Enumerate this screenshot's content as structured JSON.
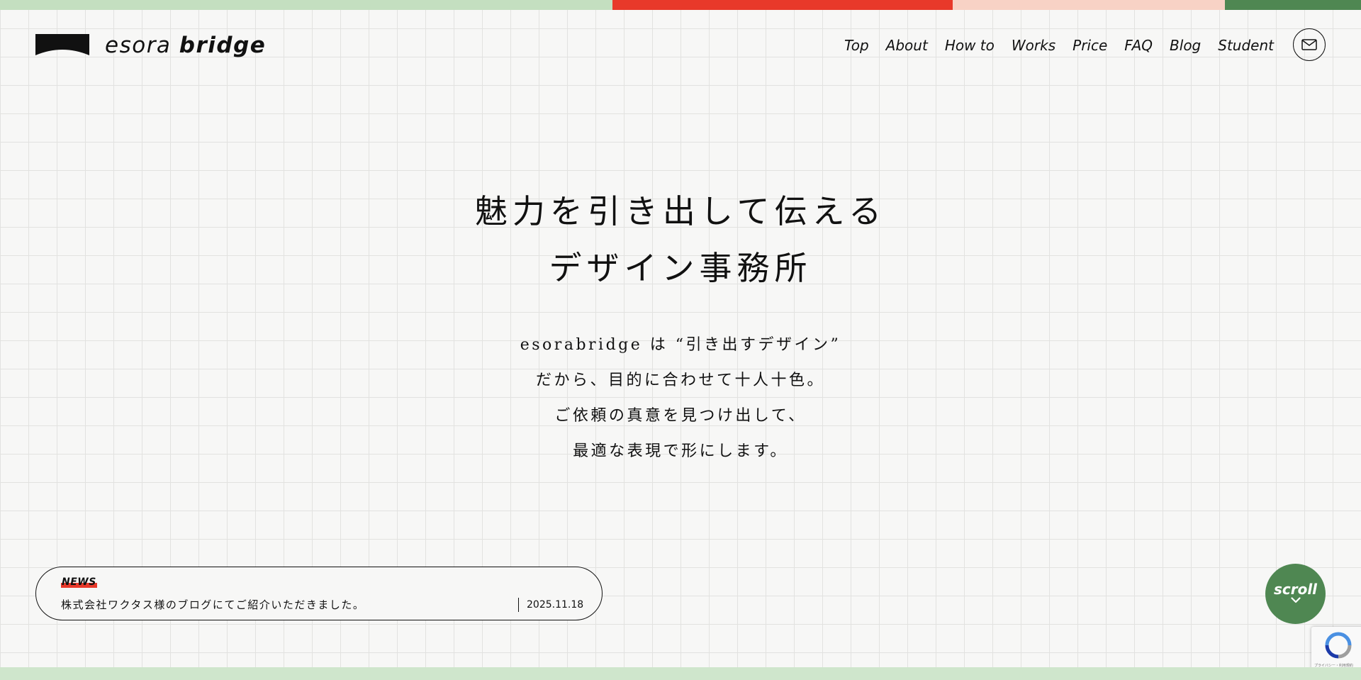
{
  "colors": {
    "bar_green_light": "#c4dfc0",
    "bar_red": "#e8392a",
    "bar_pink": "#f8d2c5",
    "bar_green_dark": "#4f8752",
    "bottom_bar": "#cfe6cc",
    "scroll_bg": "#4f8752",
    "news_highlight": "#e8392a"
  },
  "logo": {
    "icon": "logo-arch-icon",
    "text_light": "esora",
    "text_bold": "bridge"
  },
  "nav": {
    "items": [
      {
        "label": "Top"
      },
      {
        "label": "About"
      },
      {
        "label": "How to"
      },
      {
        "label": "Works"
      },
      {
        "label": "Price"
      },
      {
        "label": "FAQ"
      },
      {
        "label": "Blog"
      },
      {
        "label": "Student"
      }
    ],
    "contact_icon": "mail-icon"
  },
  "hero": {
    "title_line1": "魅力を引き出して伝える",
    "title_line2": "デザイン事務所",
    "body_lines": [
      "esorabridge は “引き出すデザイン”",
      "だから、目的に合わせて十人十色。",
      "ご依頼の真意を見つけ出して、",
      "最適な表現で形にします。"
    ]
  },
  "news": {
    "label": "NEWS",
    "text": "株式会社ワクタス様のブログにてご紹介いただきました。",
    "date": "2025.11.18"
  },
  "scroll": {
    "label": "scroll",
    "icon": "chevron-down-icon"
  },
  "recaptcha": {
    "icon": "recaptcha-icon",
    "subtext": "プライバシー・利用規約"
  }
}
